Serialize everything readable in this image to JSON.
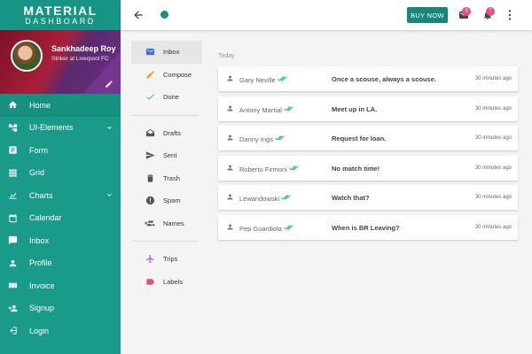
{
  "brand": {
    "line1": "MATERIAL",
    "line2": "DASHBOARD"
  },
  "profile": {
    "name": "Sankhadeep Roy",
    "subtitle": "Striker at Liverpool FC"
  },
  "sidebar": {
    "items": [
      {
        "label": "Home",
        "icon": "home-icon"
      },
      {
        "label": "UI-Elements",
        "icon": "ui-elements-icon"
      },
      {
        "label": "Form",
        "icon": "form-icon"
      },
      {
        "label": "Grid",
        "icon": "grid-icon"
      },
      {
        "label": "Charts",
        "icon": "chart-icon"
      },
      {
        "label": "Calendar",
        "icon": "calendar-icon"
      },
      {
        "label": "Inbox",
        "icon": "inbox-icon"
      },
      {
        "label": "Profile",
        "icon": "profile-icon"
      },
      {
        "label": "Invoice",
        "icon": "invoice-icon"
      },
      {
        "label": "Signup",
        "icon": "signup-icon"
      },
      {
        "label": "Login",
        "icon": "login-icon"
      }
    ]
  },
  "topbar": {
    "buy_label": "BUY NOW",
    "mail_badge": "3",
    "notif_badge": "7"
  },
  "mailnav": {
    "items": [
      {
        "label": "Inbox",
        "icon": "inbox-icon",
        "color": "#3f6fd8"
      },
      {
        "label": "Compose",
        "icon": "pencil-icon",
        "color": "#f0a020"
      },
      {
        "label": "Done",
        "icon": "check-icon",
        "color": "#2ec27e"
      },
      {
        "label": "Drafts",
        "icon": "drafts-icon",
        "color": "#555555"
      },
      {
        "label": "Sent",
        "icon": "send-icon",
        "color": "#555555"
      },
      {
        "label": "Trash",
        "icon": "trash-icon",
        "color": "#555555"
      },
      {
        "label": "Spam",
        "icon": "spam-icon",
        "color": "#555555"
      },
      {
        "label": "Names",
        "icon": "group-add-icon",
        "color": "#555555"
      },
      {
        "label": "Trips",
        "icon": "plane-icon",
        "color": "#b86ce0"
      },
      {
        "label": "Labels",
        "icon": "label-icon",
        "color": "#ea4b7c"
      }
    ]
  },
  "maillist": {
    "section": "Today",
    "messages": [
      {
        "from": "Gary Neville",
        "subject": "Once a scouse, always a scouse.",
        "time": "30 minutes ago"
      },
      {
        "from": "Antony Martial",
        "subject": "Meet up in LA.",
        "time": "30 minutes ago"
      },
      {
        "from": "Danny Ings",
        "subject": "Request for loan.",
        "time": "30 minutes ago"
      },
      {
        "from": "Roberto Firmoni",
        "subject": "No match time!",
        "time": "30 minutes ago"
      },
      {
        "from": "Lewandowski",
        "subject": "Watch that?",
        "time": "30 minutes ago"
      },
      {
        "from": "Pep Guardiola",
        "subject": "When is BR Leaving?",
        "time": "30 minutes ago"
      }
    ]
  },
  "colors": {
    "accent": "#1a9b8a",
    "badge": "#ea4b7c",
    "read_check": "#2ec27e"
  }
}
